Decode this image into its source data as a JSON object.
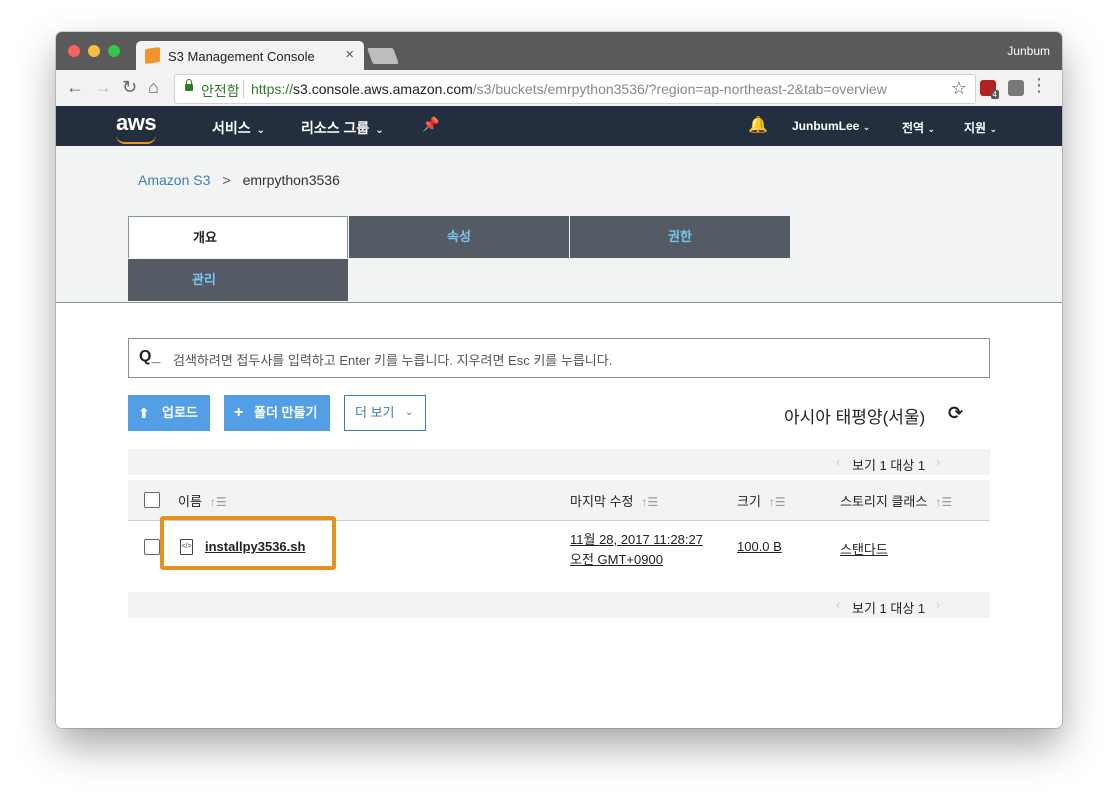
{
  "browser": {
    "tab_title": "S3 Management Console",
    "tab_close": "×",
    "profile_name": "Junbum",
    "secure_label": "안전함",
    "url_scheme": "https://",
    "url_host": "s3.console.aws.amazon.com",
    "url_path": "/s3/buckets/emrpython3536/?region=ap-northeast-2&tab=overview",
    "ext_badge": "4"
  },
  "aws_nav": {
    "logo": "aws",
    "services": "서비스",
    "resource_groups": "리소스 그룹",
    "user": "JunbumLee",
    "region": "전역",
    "support": "지원"
  },
  "breadcrumb": {
    "root": "Amazon S3",
    "separator": ">",
    "current": "emrpython3536"
  },
  "tabs": {
    "overview": "개요",
    "properties": "속성",
    "permissions": "권한",
    "management": "관리"
  },
  "search": {
    "placeholder": "검색하려면 접두사를 입력하고 Enter 키를 누릅니다. 지우려면 Esc 키를 누릅니다."
  },
  "actions": {
    "upload": "업로드",
    "create_folder": "폴더 만들기",
    "more": "더 보기",
    "region": "아시아 태평양(서울)"
  },
  "pager": {
    "text": "보기 1 대상 1"
  },
  "table": {
    "headers": {
      "name": "이름",
      "last_modified": "마지막 수정",
      "size": "크기",
      "storage_class": "스토리지 클래스"
    },
    "rows": [
      {
        "name": "installpy3536.sh",
        "modified_line1": "11월 28, 2017 11:28:27",
        "modified_line2": "오전 GMT+0900",
        "size": "100.0 B",
        "storage_class": "스탠다드"
      }
    ]
  },
  "colors": {
    "aws_nav_bg": "#232f3e",
    "aws_orange": "#f0952c",
    "tab_dark": "#545b64",
    "button_blue": "#539fe5",
    "highlight": "#e8921e"
  }
}
